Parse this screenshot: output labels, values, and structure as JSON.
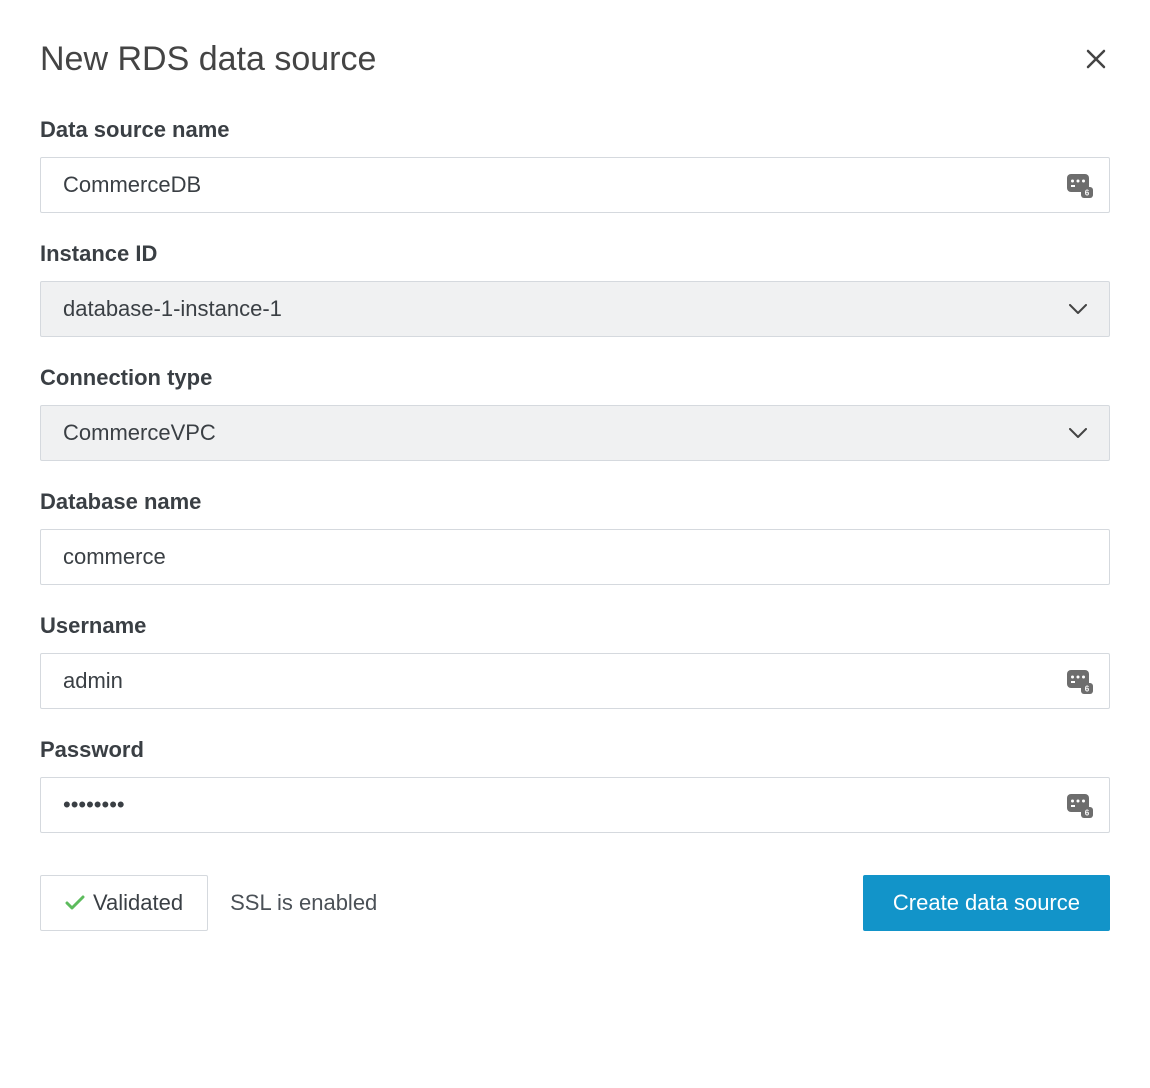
{
  "header": {
    "title": "New RDS data source"
  },
  "fields": {
    "dataSourceName": {
      "label": "Data source name",
      "value": "CommerceDB"
    },
    "instanceId": {
      "label": "Instance ID",
      "value": "database-1-instance-1"
    },
    "connectionType": {
      "label": "Connection type",
      "value": "CommerceVPC"
    },
    "databaseName": {
      "label": "Database name",
      "value": "commerce"
    },
    "username": {
      "label": "Username",
      "value": "admin"
    },
    "password": {
      "label": "Password",
      "value": "••••••••"
    }
  },
  "footer": {
    "validatedLabel": "Validated",
    "sslStatus": "SSL is enabled",
    "createLabel": "Create data source"
  },
  "colors": {
    "primary": "#1294c9",
    "success": "#5dbb5d"
  }
}
